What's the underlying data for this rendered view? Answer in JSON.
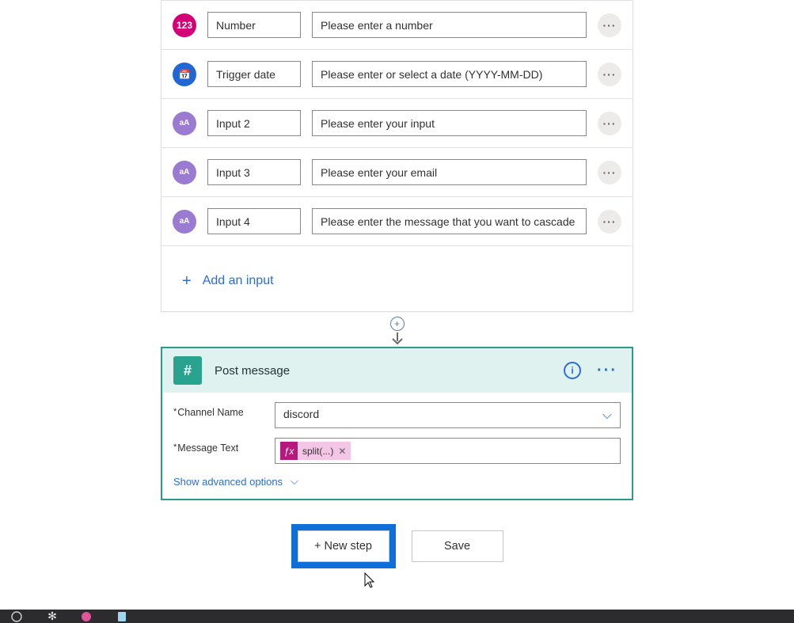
{
  "trigger": {
    "rows": [
      {
        "icon": "number-icon",
        "iconClass": "ic-number",
        "glyph": "123",
        "name": "Number",
        "placeholder": "Please enter a number"
      },
      {
        "icon": "date-icon",
        "iconClass": "ic-date",
        "glyph": "📅",
        "name": "Trigger date",
        "placeholder": "Please enter or select a date (YYYY-MM-DD)"
      },
      {
        "icon": "text-icon",
        "iconClass": "ic-text",
        "glyph": "aA",
        "name": "Input 2",
        "placeholder": "Please enter your input"
      },
      {
        "icon": "text-icon",
        "iconClass": "ic-text",
        "glyph": "aA",
        "name": "Input 3",
        "placeholder": "Please enter your email"
      },
      {
        "icon": "text-icon",
        "iconClass": "ic-text",
        "glyph": "aA",
        "name": "Input 4",
        "placeholder": "Please enter the message that you want to cascade"
      }
    ],
    "add_input": "Add an input"
  },
  "action": {
    "title": "Post message",
    "channel_label": "Channel Name",
    "channel_value": "discord",
    "message_label": "Message Text",
    "token_text": "split(...)",
    "advanced": "Show advanced options"
  },
  "buttons": {
    "new_step": "+ New step",
    "save": "Save"
  }
}
